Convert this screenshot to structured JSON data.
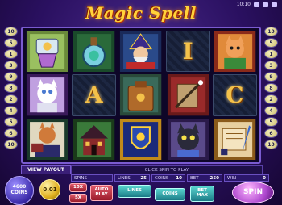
{
  "system": {
    "time": "10:10",
    "icons": [
      "settings-icon",
      "help-icon",
      "close-icon"
    ]
  },
  "logo": {
    "text": "Magic Spell"
  },
  "paylines": {
    "left": [
      "10",
      "5",
      "1",
      "3",
      "9",
      "8",
      "2",
      "4",
      "5",
      "6",
      "10"
    ],
    "right": [
      "10",
      "5",
      "1",
      "3",
      "9",
      "8",
      "2",
      "4",
      "5",
      "6",
      "10"
    ]
  },
  "reels": [
    [
      "potion-glass-icon",
      "potion-bottle-icon",
      "wizard-icon",
      "letter-i",
      "cat-sorceress-icon"
    ],
    [
      "white-cat-icon",
      "letter-a",
      "spellbook-bag-icon",
      "scroll-wand-icon",
      "letter-c"
    ],
    [
      "cat-scholar-icon",
      "haunted-house-icon",
      "crest-icon",
      "black-cat-icon",
      "scroll-quill-icon"
    ]
  ],
  "letters": {
    "letter-i": "I",
    "letter-a": "A",
    "letter-c": "C"
  },
  "controls": {
    "view_payout": "VIEW PAYOUT",
    "message": "CLICK SPIN TO PLAY",
    "spins_label": "SPINS",
    "spins_value": "",
    "lines_label": "LINES",
    "lines_value": "25",
    "coins_label": "COINS",
    "coins_value": "10",
    "bet_label": "BET",
    "bet_value": "250",
    "win_label": "WIN",
    "win_value": "0",
    "coins_balance": "4600",
    "coins_balance_label": "COINS",
    "coin_value": "0.01",
    "btn_10x": "10X",
    "btn_5x": "5X",
    "btn_autoplay": "AUTO\nPLAY",
    "btn_lines": "LINES",
    "btn_coins": "COINS",
    "btn_betmax": "BET\nMAX",
    "btn_spin": "SPIN"
  },
  "colors": {
    "accent": "#7a5bd0",
    "gold": "#ffd23a",
    "background": "#2a1060"
  }
}
